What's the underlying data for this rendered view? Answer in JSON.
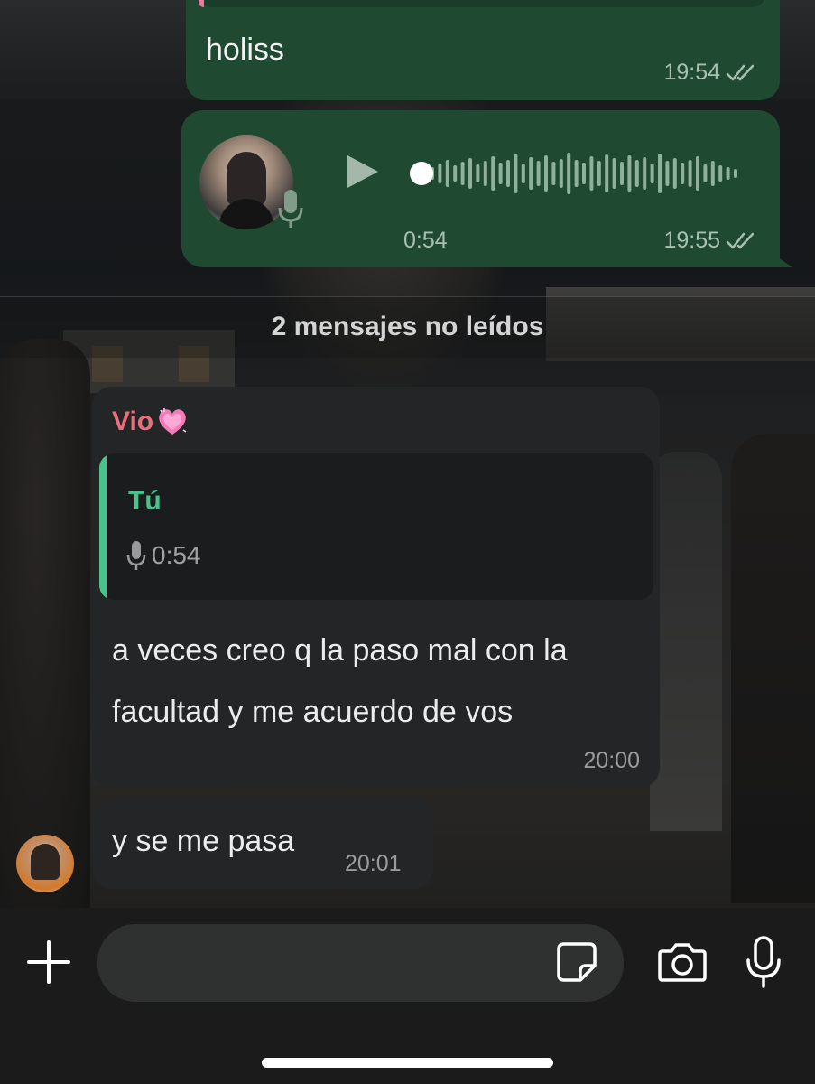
{
  "messages": [
    {
      "id": "m1",
      "direction": "outgoing",
      "type": "text",
      "text": "holiss",
      "time": "19:54",
      "status": "read"
    },
    {
      "id": "m2",
      "direction": "outgoing",
      "type": "voice",
      "duration": "0:54",
      "time": "19:55",
      "status": "read"
    },
    {
      "id": "m3",
      "direction": "incoming",
      "sender": "Vio",
      "sender_emoji": "heart-icon",
      "reply": {
        "author": "Tú",
        "type": "voice",
        "duration": "0:54"
      },
      "text": "a veces creo q la paso mal con la facultad y me acuerdo de vos",
      "time": "20:00"
    },
    {
      "id": "m4",
      "direction": "incoming",
      "text": "y se me pasa",
      "time": "20:01"
    }
  ],
  "unread_banner": "2 mensajes no leídos",
  "input": {
    "placeholder": ""
  },
  "icons": {
    "attach": "plus-icon",
    "sticker": "sticker-icon",
    "camera": "camera-icon",
    "mic": "microphone-icon",
    "play": "play-icon",
    "read_status": "double-check-icon"
  },
  "colors": {
    "outgoing_bubble": "#1f4a31",
    "incoming_bubble": "#242526",
    "sender_name": "#ea6f7a",
    "reply_accent": "#46c48c"
  }
}
